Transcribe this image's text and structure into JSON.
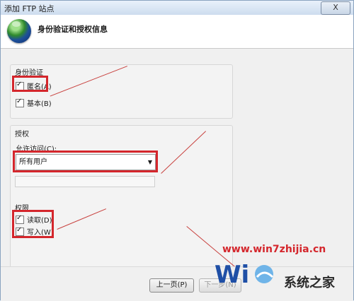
{
  "window": {
    "title": "添加 FTP 站点",
    "close_label": "X"
  },
  "header": {
    "title": "身份验证和授权信息"
  },
  "auth_section": {
    "title": "身份验证",
    "anonymous_label": "匿名(A)",
    "basic_label": "基本(B)"
  },
  "authz_section": {
    "title": "授权",
    "allow_label": "允许访问(C):",
    "allow_value": "所有用户"
  },
  "perm_section": {
    "title": "权限",
    "read_label": "读取(D)",
    "write_label": "写入(W)"
  },
  "footer": {
    "prev_label": "上一页(P)",
    "next_label": "下一步(N)"
  },
  "watermark": {
    "url": "www.win7zhijia.cn",
    "brand": "系统之家"
  },
  "colors": {
    "highlight": "#d4262c",
    "arrow": "#c8413e"
  }
}
